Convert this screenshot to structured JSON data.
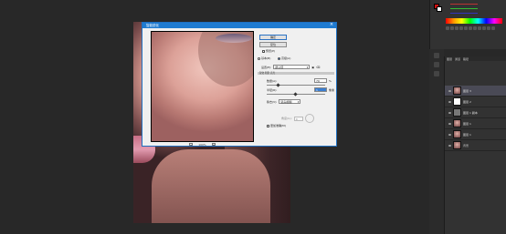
{
  "dialog": {
    "title": "智能锐化",
    "buttons": {
      "ok": "确定",
      "cancel": "复位"
    },
    "preview_check": "预览(P)",
    "mode_basic": "基本(B)",
    "mode_advanced": "高级(A)",
    "settings_label": "设置(E):",
    "settings_value": "默认值",
    "tabs_label": "锐化   阴影   高光",
    "amount_label": "数量(A):",
    "amount_value": "79",
    "amount_unit": "%",
    "radius_label": "半径(R):",
    "radius_value": "1",
    "radius_unit": "像素",
    "remove_label": "移去(V):",
    "remove_value": "镜头模糊",
    "angle_label": "角度(G):",
    "angle_value": "0",
    "accurate_label": "更加准确(M)",
    "zoom_value": "100%"
  },
  "layers": {
    "tabs": [
      "图层",
      "通道",
      "路径"
    ],
    "items": [
      {
        "name": "图层 3",
        "selected": true
      },
      {
        "name": "图层 2",
        "selected": false
      },
      {
        "name": "图层 1 副本",
        "selected": false
      },
      {
        "name": "图层 1",
        "selected": false
      },
      {
        "name": "图层 1",
        "selected": false
      },
      {
        "name": "背景",
        "selected": false
      }
    ]
  },
  "colors": {
    "foreground": "#cc1111",
    "accent": "#1f7bd1"
  }
}
